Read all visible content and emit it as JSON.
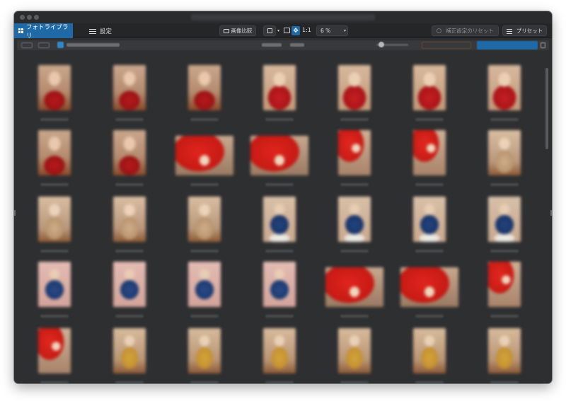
{
  "toolbar": {
    "library_tab": "フォトライブラリ",
    "settings_tab": "設定",
    "compare_label": "画像比較",
    "actual_size_label": "1:1",
    "zoom_value": "6 %",
    "reset_label": "補正設定のリセット",
    "preset_label": "プリセット",
    "dropdown_glyph": "▾",
    "move_glyph": "✥"
  },
  "colors": {
    "accent": "#1f6aa6",
    "window_bg": "#2e2f31",
    "toolbar_bg": "#252628"
  },
  "icons": {
    "library": "grid-icon",
    "settings": "sliders-icon",
    "compare": "compare-icon",
    "view": "view-layout-icon",
    "crop": "crop-icon",
    "move": "move-icon",
    "reset": "reset-icon",
    "preset": "preset-list-icon",
    "share": "share-icon",
    "folder": "folder-icon"
  },
  "grid": {
    "columns": 7,
    "rows": 5,
    "thumbnails": [
      "t-red",
      "t-red",
      "t-red",
      "t-red2",
      "t-red2",
      "t-red2",
      "t-red2",
      "t-red",
      "t-red",
      "t-umbrella",
      "t-umbrella",
      "t-umbrella-t",
      "t-umbrella-t",
      "t-beige",
      "t-beige",
      "t-beige",
      "t-beige",
      "t-blue",
      "t-blue",
      "t-blue",
      "t-blue",
      "t-blue-pink",
      "t-blue-pink",
      "t-blue-pink",
      "t-blue-pink",
      "t-umbrella",
      "t-umbrella",
      "t-umbrella-t",
      "t-umbrella-t",
      "t-yellow",
      "t-yellow",
      "t-yellow",
      "t-yellow",
      "t-yellow",
      "t-yellow"
    ],
    "wide": [
      9,
      10,
      25,
      26
    ]
  }
}
